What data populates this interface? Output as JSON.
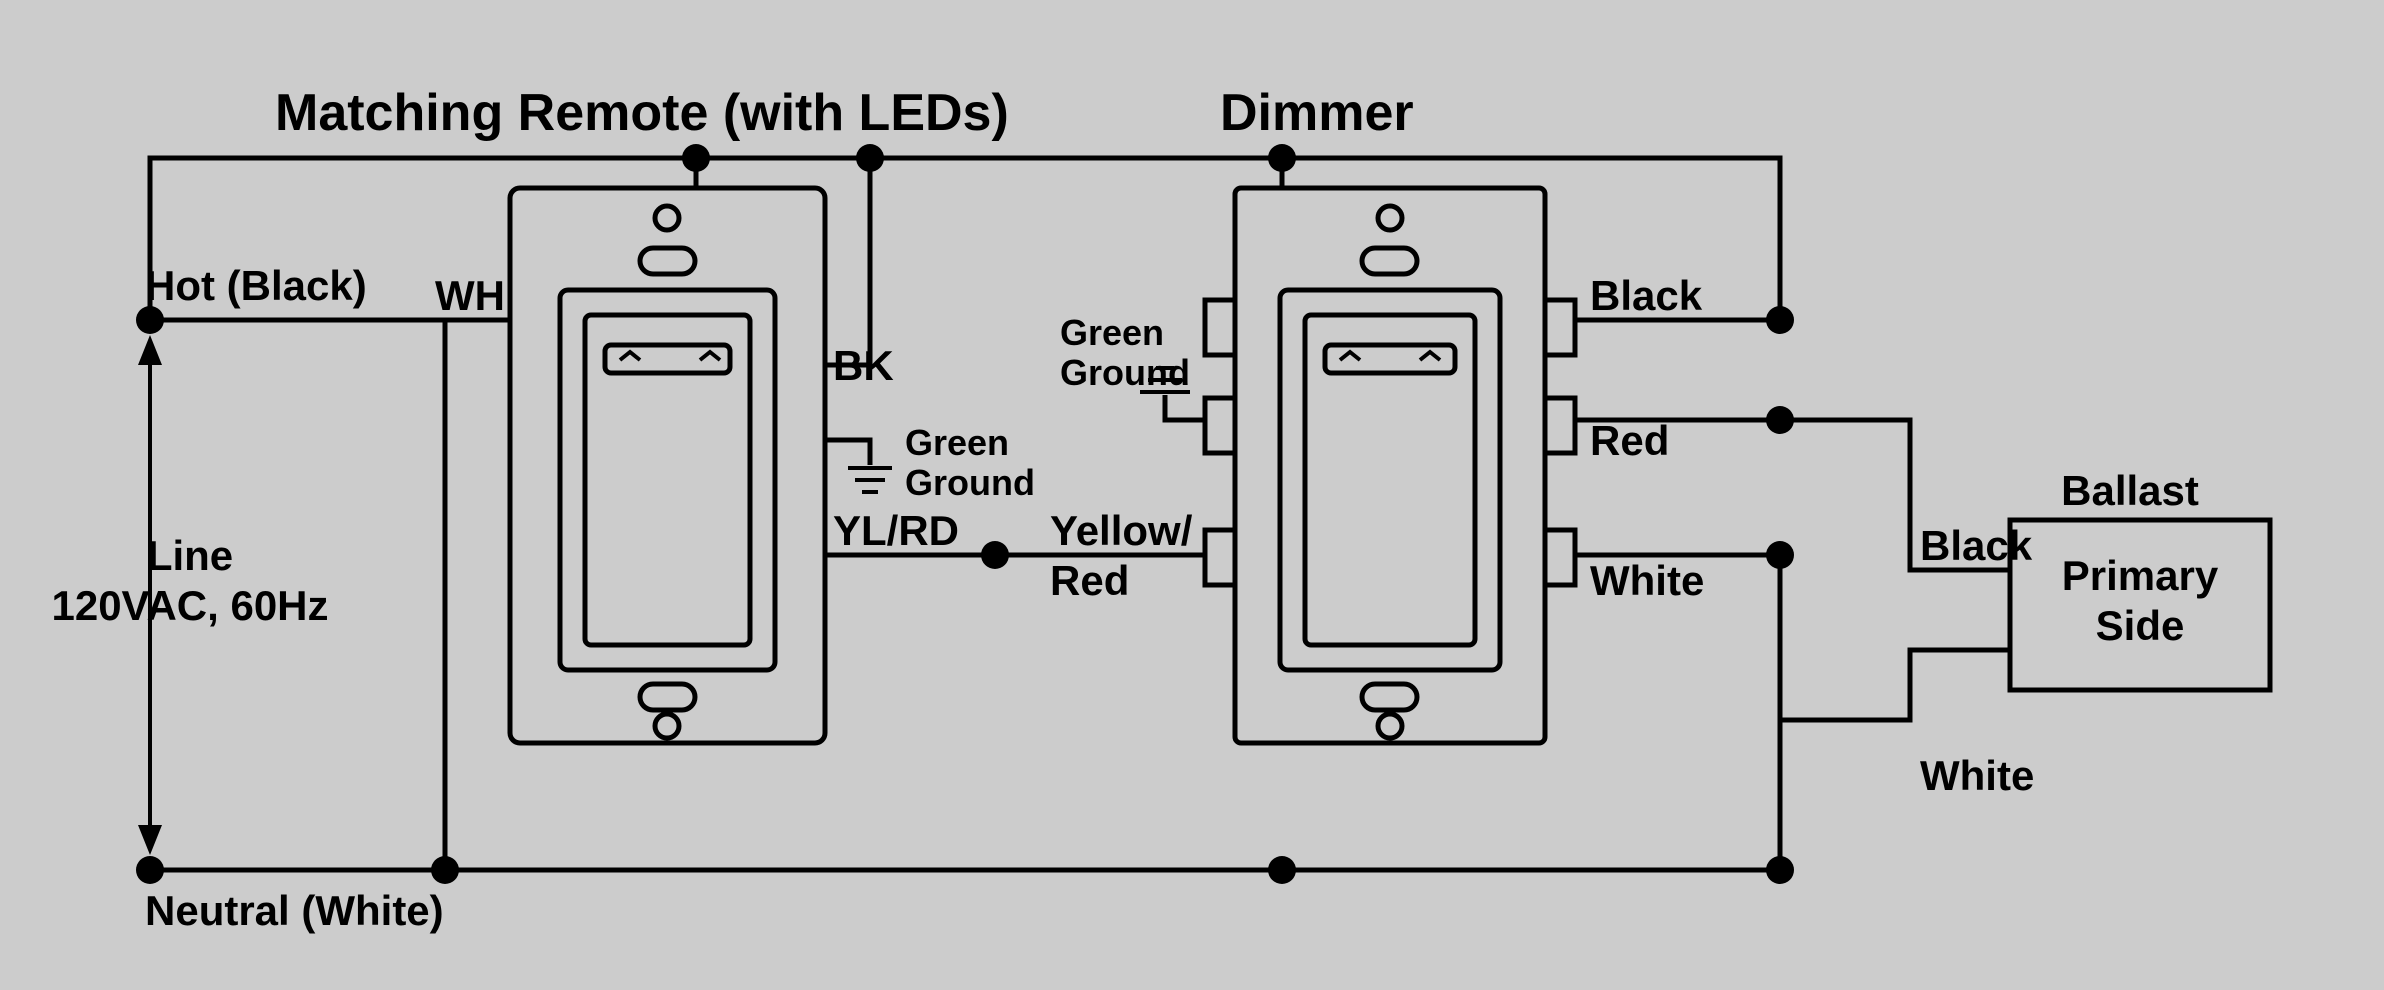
{
  "titles": {
    "remote": "Matching Remote (with LEDs)",
    "dimmer": "Dimmer"
  },
  "source": {
    "hot": "Hot (Black)",
    "line": "Line\n120VAC, 60Hz",
    "neutral": "Neutral (White)"
  },
  "remote_terminals": {
    "wh": "WH",
    "bk": "BK",
    "ylrd": "YL/RD",
    "ground": "Green\nGround"
  },
  "dimmer_terminals": {
    "black": "Black",
    "red": "Red",
    "white": "White",
    "yellow_red": "Yellow/\nRed",
    "ground": "Green\nGround"
  },
  "ballast": {
    "title": "Ballast",
    "box": "Primary\nSide",
    "to_black": "Black",
    "to_white": "White"
  }
}
